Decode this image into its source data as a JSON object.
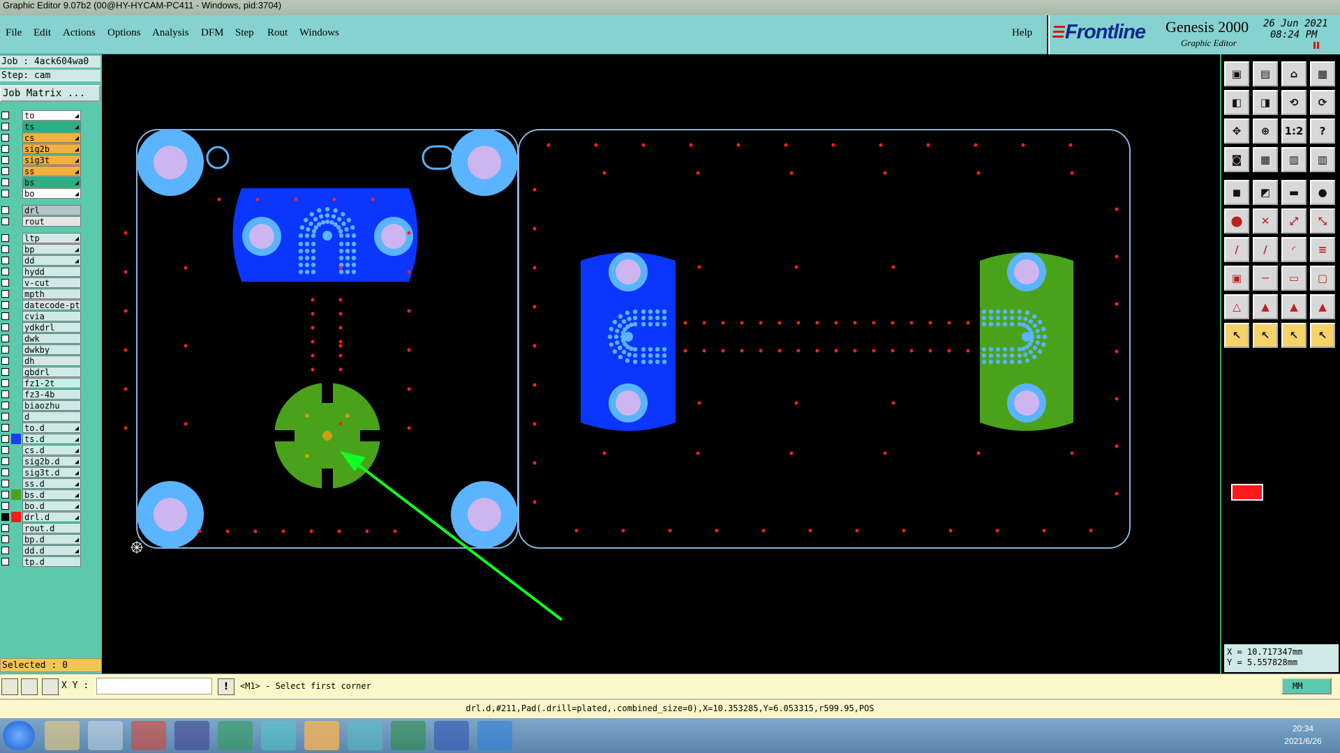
{
  "window": {
    "title": "Graphic Editor 9.07b2 (00@HY-HYCAM-PC411 - Windows, pid:3704)"
  },
  "menu": [
    "File",
    "Edit",
    "Actions",
    "Options",
    "Analysis",
    "DFM",
    "Step",
    "Rout",
    "Windows"
  ],
  "help_label": "Help",
  "brand": {
    "logo": "Frontline",
    "product": "Genesis 2000",
    "subtitle": "Graphic Editor",
    "date": "26 Jun 2021",
    "time": "08:24 PM"
  },
  "job": {
    "job_line": "Job : 4ack604wa0",
    "step_line": "Step: cam",
    "matrix_label": "Job Matrix ..."
  },
  "layers": [
    {
      "name": "to",
      "color": "#ffffff",
      "arrow": true
    },
    {
      "name": "ts",
      "color": "#27b283",
      "arrow": true
    },
    {
      "name": "cs",
      "color": "#f2b03c",
      "arrow": true
    },
    {
      "name": "sig2b",
      "color": "#f2b03c",
      "arrow": true
    },
    {
      "name": "sig3t",
      "color": "#f2b03c",
      "arrow": true
    },
    {
      "name": "ss",
      "color": "#f2b03c",
      "arrow": true
    },
    {
      "name": "bs",
      "color": "#27b283",
      "arrow": true
    },
    {
      "name": "bo",
      "color": "#ffffff",
      "arrow": true
    },
    {
      "name": "drl",
      "color": "#b3c6c6",
      "arrow": false
    },
    {
      "name": "rout",
      "color": "#e6e6e6",
      "arrow": false
    },
    {
      "name": "ltp",
      "color": "#cfe9e6",
      "arrow": true
    },
    {
      "name": "bp",
      "color": "#cfe9e6",
      "arrow": true
    },
    {
      "name": "dd",
      "color": "#cfe9e6",
      "arrow": true
    },
    {
      "name": "hydd",
      "color": "#cfe9e6",
      "arrow": false
    },
    {
      "name": "v-cut",
      "color": "#cfe9e6",
      "arrow": false
    },
    {
      "name": "mpth",
      "color": "#cfe9e6",
      "arrow": false
    },
    {
      "name": "datecode-pt",
      "color": "#cfe9e6",
      "arrow": false
    },
    {
      "name": "cvia",
      "color": "#cfe9e6",
      "arrow": false
    },
    {
      "name": "ydkdrl",
      "color": "#cfe9e6",
      "arrow": false
    },
    {
      "name": "dwk",
      "color": "#cfe9e6",
      "arrow": false
    },
    {
      "name": "dwkby",
      "color": "#cfe9e6",
      "arrow": false
    },
    {
      "name": "dh",
      "color": "#cfe9e6",
      "arrow": false
    },
    {
      "name": "gbdrl",
      "color": "#cfe9e6",
      "arrow": false
    },
    {
      "name": "fz1-2t",
      "color": "#cfe9e6",
      "arrow": false
    },
    {
      "name": "fz3-4b",
      "color": "#cfe9e6",
      "arrow": false
    },
    {
      "name": "biaozhu",
      "color": "#cfe9e6",
      "arrow": false
    },
    {
      "name": "d",
      "color": "#cfe9e6",
      "arrow": false
    },
    {
      "name": "to.d",
      "color": "#cfe9e6",
      "arrow": true
    },
    {
      "name": "ts.d",
      "color": "#cfe9e6",
      "arrow": true,
      "swatch": "#1a3cff"
    },
    {
      "name": "cs.d",
      "color": "#cfe9e6",
      "arrow": true
    },
    {
      "name": "sig2b.d",
      "color": "#cfe9e6",
      "arrow": true
    },
    {
      "name": "sig3t.d",
      "color": "#cfe9e6",
      "arrow": true
    },
    {
      "name": "ss.d",
      "color": "#cfe9e6",
      "arrow": true
    },
    {
      "name": "bs.d",
      "color": "#cfe9e6",
      "arrow": true,
      "swatch": "#4aa21a"
    },
    {
      "name": "bo.d",
      "color": "#cfe9e6",
      "arrow": true
    },
    {
      "name": "drl.d",
      "color": "#cfe9e6",
      "arrow": true,
      "swatch": "#ff1a1a",
      "checked": true
    },
    {
      "name": "rout.d",
      "color": "#cfe9e6",
      "arrow": false
    },
    {
      "name": "bp.d",
      "color": "#cfe9e6",
      "arrow": true
    },
    {
      "name": "dd.d",
      "color": "#cfe9e6",
      "arrow": true
    },
    {
      "name": "tp.d",
      "color": "#cfe9e6",
      "arrow": false
    }
  ],
  "selected_label": "Selected : 0",
  "coords": {
    "x": "X = 10.717347mm",
    "y": "Y = 5.557828mm"
  },
  "cmd": {
    "xy_label": "X Y :",
    "prompt": "<M1> - Select first corner",
    "units": "MM"
  },
  "status": "drl.d,#211,Pad(.drill=plated,.combined_size=0),X=10.353285,Y=6.053315,r599.95,POS",
  "tray": {
    "time": "20:34",
    "date": "2021/6/26"
  },
  "colors": {
    "panel": "#86d2d0",
    "outline": "#8ab4e0",
    "pad": "#5ab4ff",
    "pad_inner": "#cdb6f0",
    "blue": "#0a36ff",
    "green": "#4aa21a",
    "drill": "#ff2020",
    "arrow": "#11ff22"
  }
}
